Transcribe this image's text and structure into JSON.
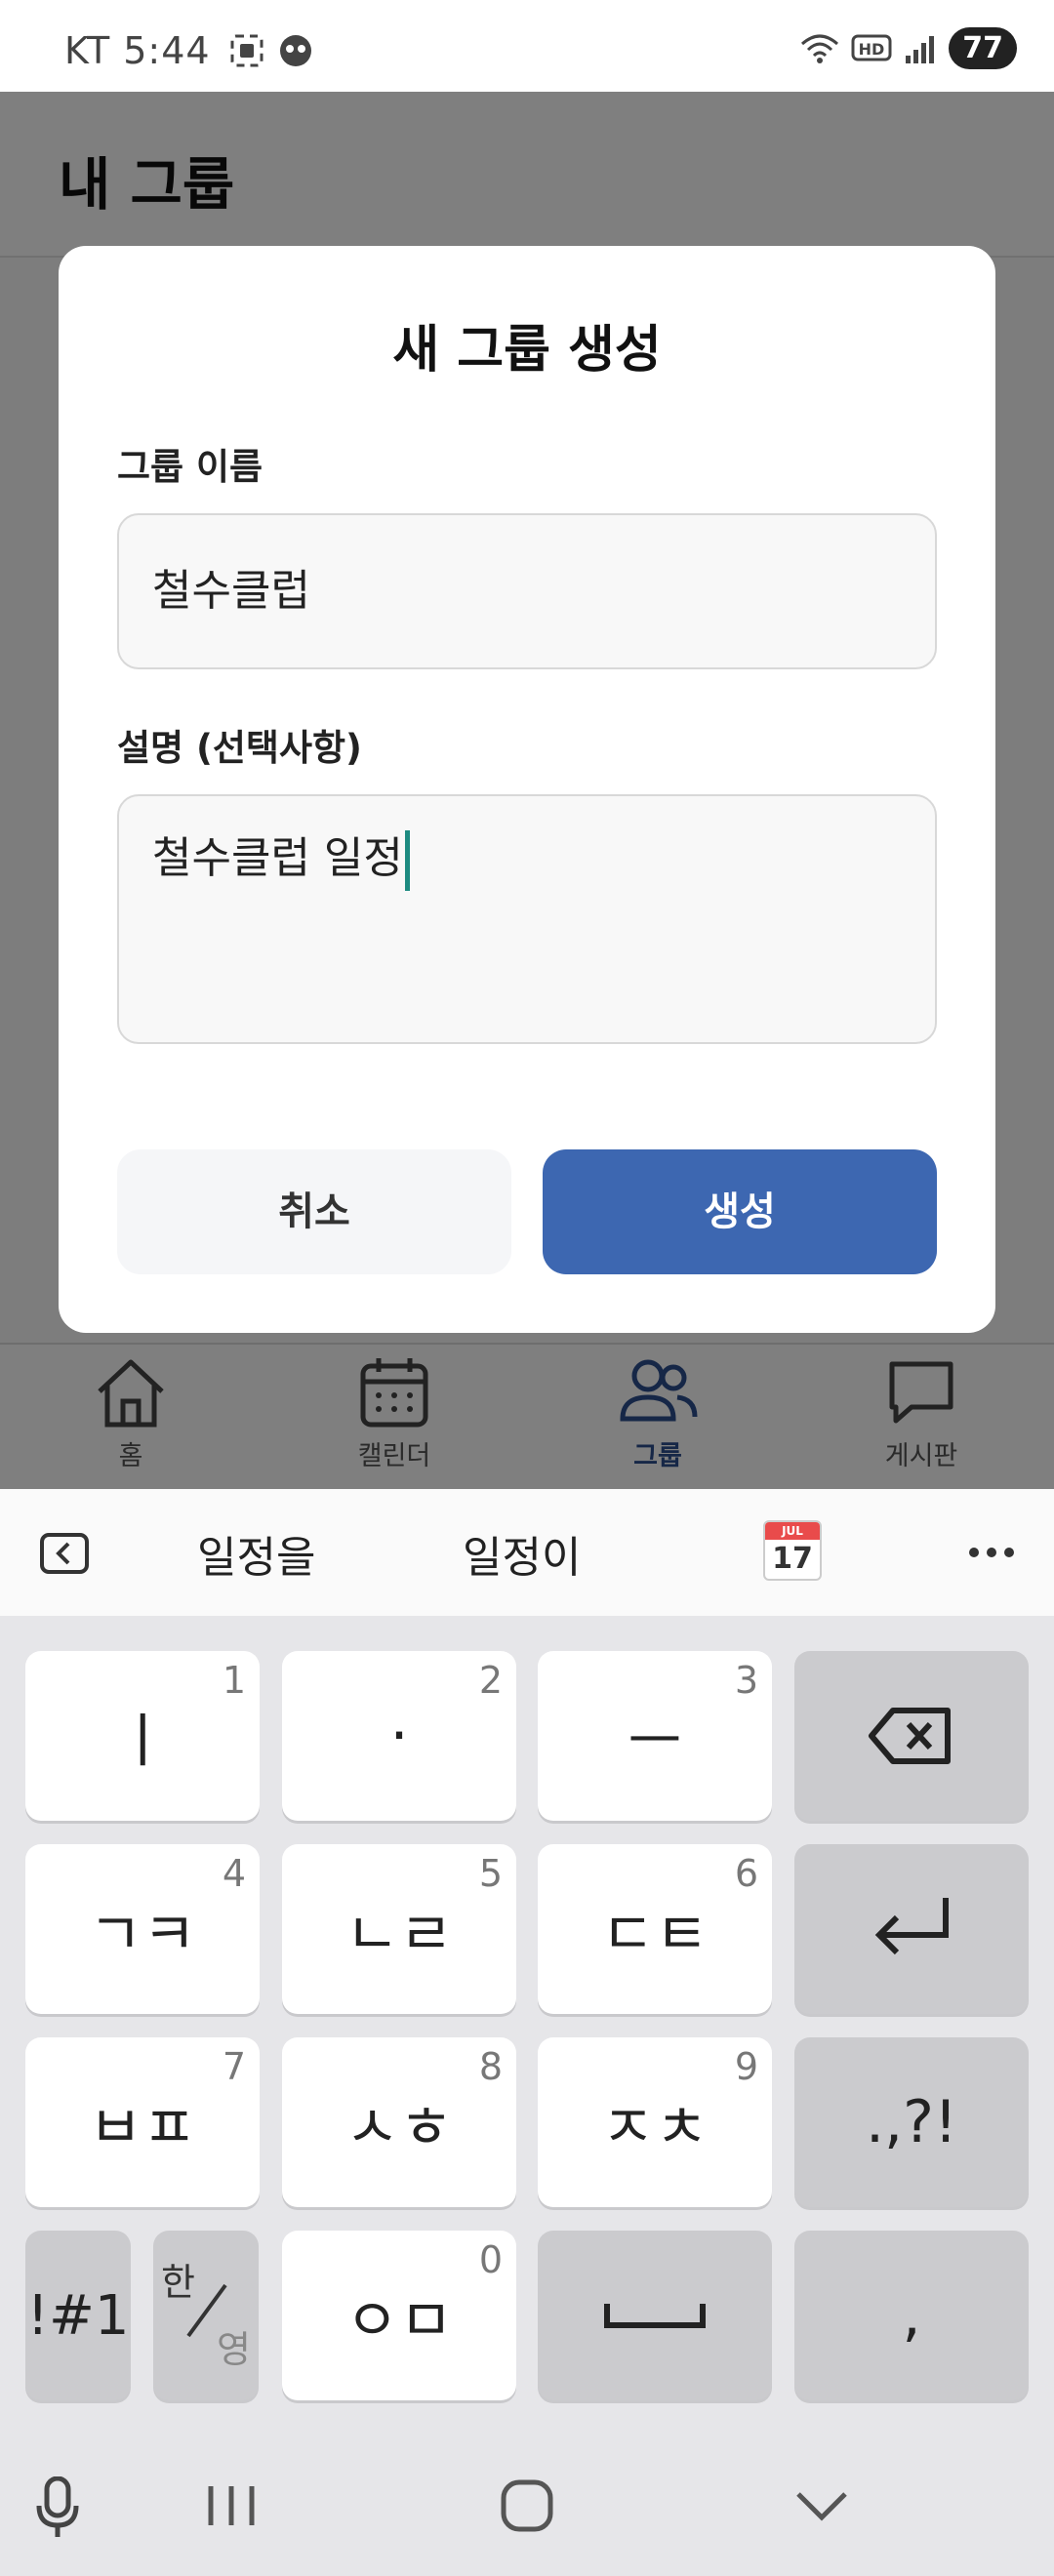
{
  "status_bar": {
    "carrier_time": "KT 5:44",
    "battery": "77"
  },
  "app": {
    "title": "내 그룹"
  },
  "dialog": {
    "title": "새 그룹 생성",
    "name_label": "그룹 이름",
    "name_value": "철수클럽",
    "desc_label": "설명 (선택사항)",
    "desc_value": "철수클럽 일정",
    "cancel_label": "취소",
    "create_label": "생성",
    "accent_color": "#3d67b1"
  },
  "bottom_nav": {
    "items": [
      {
        "label": "홈",
        "icon": "home-icon"
      },
      {
        "label": "캘린더",
        "icon": "calendar-icon"
      },
      {
        "label": "그룹",
        "icon": "group-icon",
        "active": true
      },
      {
        "label": "게시판",
        "icon": "chat-bubble-icon"
      }
    ]
  },
  "keyboard": {
    "suggestions": [
      "일정을",
      "일정이"
    ],
    "calendar_emoji_day": "17",
    "calendar_emoji_month": "JUL",
    "rows": [
      [
        {
          "label": "ㅣ",
          "num": "1"
        },
        {
          "label": "·",
          "num": "2"
        },
        {
          "label": "ㅡ",
          "num": "3"
        }
      ],
      [
        {
          "label": "ㄱㅋ",
          "num": "4"
        },
        {
          "label": "ㄴㄹ",
          "num": "5"
        },
        {
          "label": "ㄷㅌ",
          "num": "6"
        }
      ],
      [
        {
          "label": "ㅂㅍ",
          "num": "7"
        },
        {
          "label": "ㅅㅎ",
          "num": "8"
        },
        {
          "label": "ㅈㅊ",
          "num": "9"
        }
      ]
    ],
    "punct_key": ".,?!",
    "symbols_key": "!#1",
    "lang_key_top": "한",
    "lang_key_bottom": "영",
    "zero_key": "ㅇㅁ",
    "zero_num": "0",
    "comma_key": ","
  }
}
